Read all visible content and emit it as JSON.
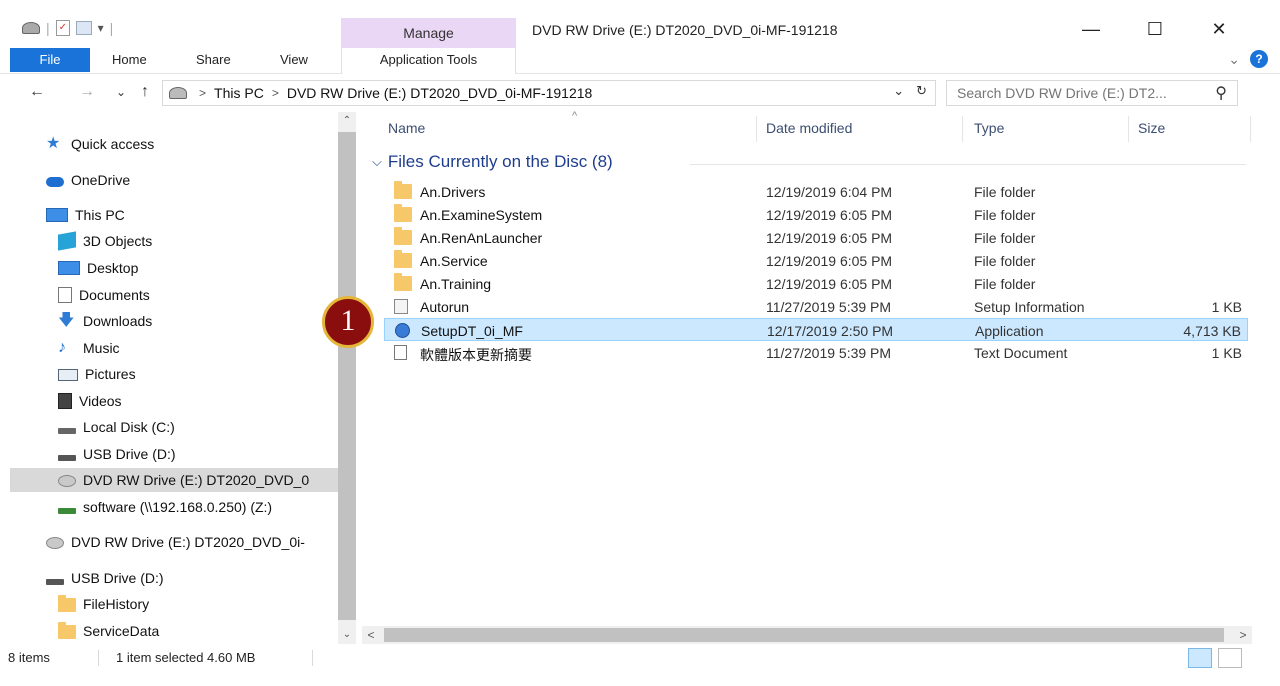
{
  "window": {
    "title": "DVD RW Drive (E:) DT2020_DVD_0i-MF-191218",
    "context_tab": "Manage",
    "minimize": "—",
    "maximize": "☐",
    "close": "✕"
  },
  "ribbon": {
    "file": "File",
    "tabs": [
      "Home",
      "Share",
      "View"
    ],
    "app_tools": "Application Tools",
    "collapse": "⌄",
    "help": "?"
  },
  "nav": {
    "back": "←",
    "forward": "→",
    "recent": "⌄",
    "up": "↑"
  },
  "address": {
    "crumbs": [
      "This PC",
      "DVD RW Drive (E:) DT2020_DVD_0i-MF-191218"
    ],
    "dropdown": "⌄",
    "refresh": "↻"
  },
  "search": {
    "placeholder": "Search DVD RW Drive (E:) DT2...",
    "icon": "⚲"
  },
  "sidebar": {
    "items": [
      {
        "label": "Quick access",
        "icon": "star-icon"
      },
      {
        "label": "OneDrive",
        "icon": "cloud-icon"
      },
      {
        "label": "This PC",
        "icon": "computer-icon"
      },
      {
        "label": "3D Objects",
        "icon": "cube-icon"
      },
      {
        "label": "Desktop",
        "icon": "desktop-icon"
      },
      {
        "label": "Documents",
        "icon": "documents-icon"
      },
      {
        "label": "Downloads",
        "icon": "download-icon"
      },
      {
        "label": "Music",
        "icon": "music-icon"
      },
      {
        "label": "Pictures",
        "icon": "pictures-icon"
      },
      {
        "label": "Videos",
        "icon": "videos-icon"
      },
      {
        "label": "Local Disk (C:)",
        "icon": "hard-drive-icon"
      },
      {
        "label": "USB Drive (D:)",
        "icon": "usb-drive-icon"
      },
      {
        "label": "DVD RW Drive (E:) DT2020_DVD_0",
        "icon": "dvd-drive-icon"
      },
      {
        "label": "software (\\\\192.168.0.250) (Z:)",
        "icon": "network-drive-icon"
      },
      {
        "label": "DVD RW Drive (E:) DT2020_DVD_0i-",
        "icon": "dvd-drive-icon"
      },
      {
        "label": "USB Drive (D:)",
        "icon": "usb-drive-icon"
      },
      {
        "label": "FileHistory",
        "icon": "folder-icon"
      },
      {
        "label": "ServiceData",
        "icon": "folder-icon"
      }
    ]
  },
  "columns": {
    "name": "Name",
    "date": "Date modified",
    "type": "Type",
    "size": "Size",
    "sort_indicator": "^"
  },
  "group": {
    "chevron": "⌵",
    "label": "Files Currently on the Disc (8)"
  },
  "files": [
    {
      "name": "An.Drivers",
      "date": "12/19/2019 6:04 PM",
      "type": "File folder",
      "size": "",
      "icon": "folder-icon"
    },
    {
      "name": "An.ExamineSystem",
      "date": "12/19/2019 6:05 PM",
      "type": "File folder",
      "size": "",
      "icon": "folder-icon"
    },
    {
      "name": "An.RenAnLauncher",
      "date": "12/19/2019 6:05 PM",
      "type": "File folder",
      "size": "",
      "icon": "folder-icon"
    },
    {
      "name": "An.Service",
      "date": "12/19/2019 6:05 PM",
      "type": "File folder",
      "size": "",
      "icon": "folder-icon"
    },
    {
      "name": "An.Training",
      "date": "12/19/2019 6:05 PM",
      "type": "File folder",
      "size": "",
      "icon": "folder-icon"
    },
    {
      "name": "Autorun",
      "date": "11/27/2019 5:39 PM",
      "type": "Setup Information",
      "size": "1 KB",
      "icon": "setup-info-icon"
    },
    {
      "name": "SetupDT_0i_MF",
      "date": "12/17/2019 2:50 PM",
      "type": "Application",
      "size": "4,713 KB",
      "icon": "installer-icon"
    },
    {
      "name": "軟體版本更新摘要",
      "date": "11/27/2019 5:39 PM",
      "type": "Text Document",
      "size": "1 KB",
      "icon": "text-document-icon"
    }
  ],
  "callout": "1",
  "status": {
    "items": "8 items",
    "selected": "1 item selected  4.60 MB"
  },
  "scroll": {
    "up": "⌃",
    "down": "⌄",
    "left": "<",
    "right": ">"
  },
  "colors": {
    "accent": "#1a73d9",
    "manage_tab": "#ead6f5",
    "selection": "#cce8ff",
    "callout_fill": "#8a0e0e",
    "callout_ring": "#e4b73a",
    "folder": "#f7c86a"
  }
}
